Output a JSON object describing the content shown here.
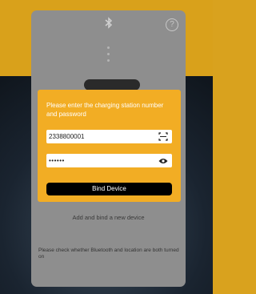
{
  "background": {
    "top_color": "#d9a11b",
    "bottom_color": "#1a2430"
  },
  "card": {
    "subtitle": "",
    "add_device_label": "Add and bind a new device",
    "notice_title": "Please check whether Bluetooth and location are both turned on",
    "notice_body": ""
  },
  "modal": {
    "title": "Please enter the charging station number and password",
    "station_number": "2338800001",
    "password_masked": "••••••",
    "bind_button_label": "Bind Device",
    "accent_color": "#f2ad24"
  },
  "icons": {
    "bluetooth": "bluetooth-icon",
    "help": "help-icon",
    "scan": "scan-icon",
    "visibility": "eye-icon"
  }
}
